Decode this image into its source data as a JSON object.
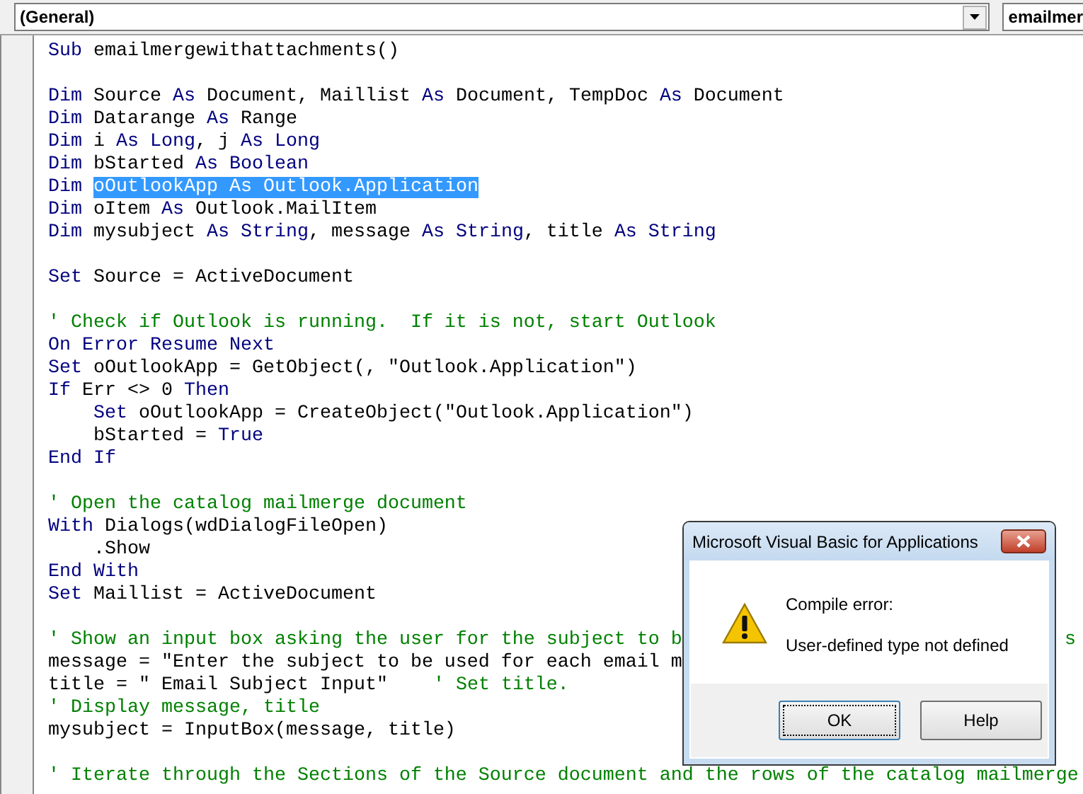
{
  "toolbar": {
    "object_box": {
      "value": "(General)"
    },
    "procedure_box": {
      "value": "emailmer"
    }
  },
  "code": {
    "lines": [
      {
        "segments": [
          {
            "kind": "keyword",
            "text": "Sub"
          },
          {
            "kind": "plain",
            "text": " emailmergewithattachments()"
          }
        ]
      },
      {
        "blank_before": true,
        "segments": [
          {
            "kind": "keyword",
            "text": "Dim"
          },
          {
            "kind": "plain",
            "text": " Source "
          },
          {
            "kind": "keyword",
            "text": "As"
          },
          {
            "kind": "plain",
            "text": " Document, Maillist "
          },
          {
            "kind": "keyword",
            "text": "As"
          },
          {
            "kind": "plain",
            "text": " Document, TempDoc "
          },
          {
            "kind": "keyword",
            "text": "As"
          },
          {
            "kind": "plain",
            "text": " Document"
          }
        ]
      },
      {
        "segments": [
          {
            "kind": "keyword",
            "text": "Dim"
          },
          {
            "kind": "plain",
            "text": " Datarange "
          },
          {
            "kind": "keyword",
            "text": "As"
          },
          {
            "kind": "plain",
            "text": " Range"
          }
        ]
      },
      {
        "segments": [
          {
            "kind": "keyword",
            "text": "Dim"
          },
          {
            "kind": "plain",
            "text": " i "
          },
          {
            "kind": "keyword",
            "text": "As Long"
          },
          {
            "kind": "plain",
            "text": ", j "
          },
          {
            "kind": "keyword",
            "text": "As Long"
          }
        ]
      },
      {
        "segments": [
          {
            "kind": "keyword",
            "text": "Dim"
          },
          {
            "kind": "plain",
            "text": " bStarted "
          },
          {
            "kind": "keyword",
            "text": "As Boolean"
          }
        ]
      },
      {
        "segments": [
          {
            "kind": "keyword",
            "text": "Dim "
          },
          {
            "kind": "selection",
            "text": "oOutlookApp As Outlook.Application"
          }
        ]
      },
      {
        "segments": [
          {
            "kind": "keyword",
            "text": "Dim"
          },
          {
            "kind": "plain",
            "text": " oItem "
          },
          {
            "kind": "keyword",
            "text": "As"
          },
          {
            "kind": "plain",
            "text": " Outlook.MailItem"
          }
        ]
      },
      {
        "segments": [
          {
            "kind": "keyword",
            "text": "Dim"
          },
          {
            "kind": "plain",
            "text": " mysubject "
          },
          {
            "kind": "keyword",
            "text": "As String"
          },
          {
            "kind": "plain",
            "text": ", message "
          },
          {
            "kind": "keyword",
            "text": "As String"
          },
          {
            "kind": "plain",
            "text": ", title "
          },
          {
            "kind": "keyword",
            "text": "As String"
          }
        ]
      },
      {
        "blank_before": true,
        "segments": [
          {
            "kind": "keyword",
            "text": "Set"
          },
          {
            "kind": "plain",
            "text": " Source = ActiveDocument"
          }
        ]
      },
      {
        "blank_before": true,
        "segments": [
          {
            "kind": "comment",
            "text": "' Check if Outlook is running.  If it is not, start Outlook"
          }
        ]
      },
      {
        "segments": [
          {
            "kind": "keyword",
            "text": "On Error Resume Next"
          }
        ]
      },
      {
        "segments": [
          {
            "kind": "keyword",
            "text": "Set"
          },
          {
            "kind": "plain",
            "text": " oOutlookApp = GetObject(, \"Outlook.Application\")"
          }
        ]
      },
      {
        "segments": [
          {
            "kind": "keyword",
            "text": "If"
          },
          {
            "kind": "plain",
            "text": " Err <> 0 "
          },
          {
            "kind": "keyword",
            "text": "Then"
          }
        ]
      },
      {
        "indented": true,
        "segments": [
          {
            "kind": "keyword",
            "text": "Set"
          },
          {
            "kind": "plain",
            "text": " oOutlookApp = CreateObject(\"Outlook.Application\")"
          }
        ]
      },
      {
        "indented": true,
        "segments": [
          {
            "kind": "plain",
            "text": "bStarted = "
          },
          {
            "kind": "keyword",
            "text": "True"
          }
        ]
      },
      {
        "segments": [
          {
            "kind": "keyword",
            "text": "End If"
          }
        ]
      },
      {
        "blank_before": true,
        "segments": [
          {
            "kind": "comment",
            "text": "' Open the catalog mailmerge document"
          }
        ]
      },
      {
        "segments": [
          {
            "kind": "keyword",
            "text": "With"
          },
          {
            "kind": "plain",
            "text": " Dialogs(wdDialogFileOpen)"
          }
        ]
      },
      {
        "indented": true,
        "segments": [
          {
            "kind": "plain",
            "text": ".Show"
          }
        ]
      },
      {
        "segments": [
          {
            "kind": "keyword",
            "text": "End With"
          }
        ]
      },
      {
        "segments": [
          {
            "kind": "keyword",
            "text": "Set"
          },
          {
            "kind": "plain",
            "text": " Maillist = ActiveDocument"
          }
        ]
      },
      {
        "blank_before": true,
        "segments": [
          {
            "kind": "comment",
            "text": "' Show an input box asking the user for the subject to b"
          }
        ],
        "tail": {
          "kind": "comment",
          "text": "s"
        }
      },
      {
        "segments": [
          {
            "kind": "plain",
            "text": "message = \"Enter the subject to be used for each email m"
          }
        ]
      },
      {
        "segments": [
          {
            "kind": "plain",
            "text": "title = \" Email Subject Input\"    "
          },
          {
            "kind": "comment",
            "text": "' Set title."
          }
        ]
      },
      {
        "segments": [
          {
            "kind": "comment",
            "text": "' Display message, title"
          }
        ]
      },
      {
        "segments": [
          {
            "kind": "plain",
            "text": "mysubject = InputBox(message, title)"
          }
        ]
      },
      {
        "blank_before": true,
        "segments": [
          {
            "kind": "comment",
            "text": "' Iterate through the Sections of the Source document and the rows of the catalog mailmerge"
          }
        ]
      }
    ]
  },
  "dialog": {
    "title": "Microsoft Visual Basic for Applications",
    "heading": "Compile error:",
    "message": "User-defined type not defined",
    "buttons": [
      {
        "label": "OK",
        "focused": true
      },
      {
        "label": "Help",
        "focused": false
      }
    ]
  }
}
